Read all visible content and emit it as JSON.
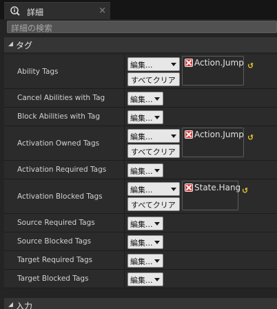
{
  "tab": {
    "title": "詳細",
    "close": "×"
  },
  "search": {
    "placeholder": "詳細の検索"
  },
  "categories": {
    "tags": "タグ",
    "input": "入力"
  },
  "edit_label": "編集...",
  "clear_all_label": "すべてクリア",
  "rows": [
    {
      "name": "Ability Tags",
      "tags": [
        "Action.Jump"
      ]
    },
    {
      "name": "Cancel Abilities with Tag",
      "tags": []
    },
    {
      "name": "Block Abilities with Tag",
      "tags": []
    },
    {
      "name": "Activation Owned Tags",
      "tags": [
        "Action.Jump"
      ]
    },
    {
      "name": "Activation Required Tags",
      "tags": []
    },
    {
      "name": "Activation Blocked Tags",
      "tags": [
        "State.Hang"
      ]
    },
    {
      "name": "Source Required Tags",
      "tags": []
    },
    {
      "name": "Source Blocked Tags",
      "tags": []
    },
    {
      "name": "Target Required Tags",
      "tags": []
    },
    {
      "name": "Target Blocked Tags",
      "tags": []
    }
  ],
  "icons": {
    "tab": "info-search-icon",
    "remove": "remove-tag-icon",
    "reset": "reset-to-default-icon",
    "expand": "expand-arrow-icon"
  },
  "colors": {
    "remove_tag": "#d53a3a",
    "reset_arrow": "#e8c52a",
    "panel": "#242424"
  }
}
